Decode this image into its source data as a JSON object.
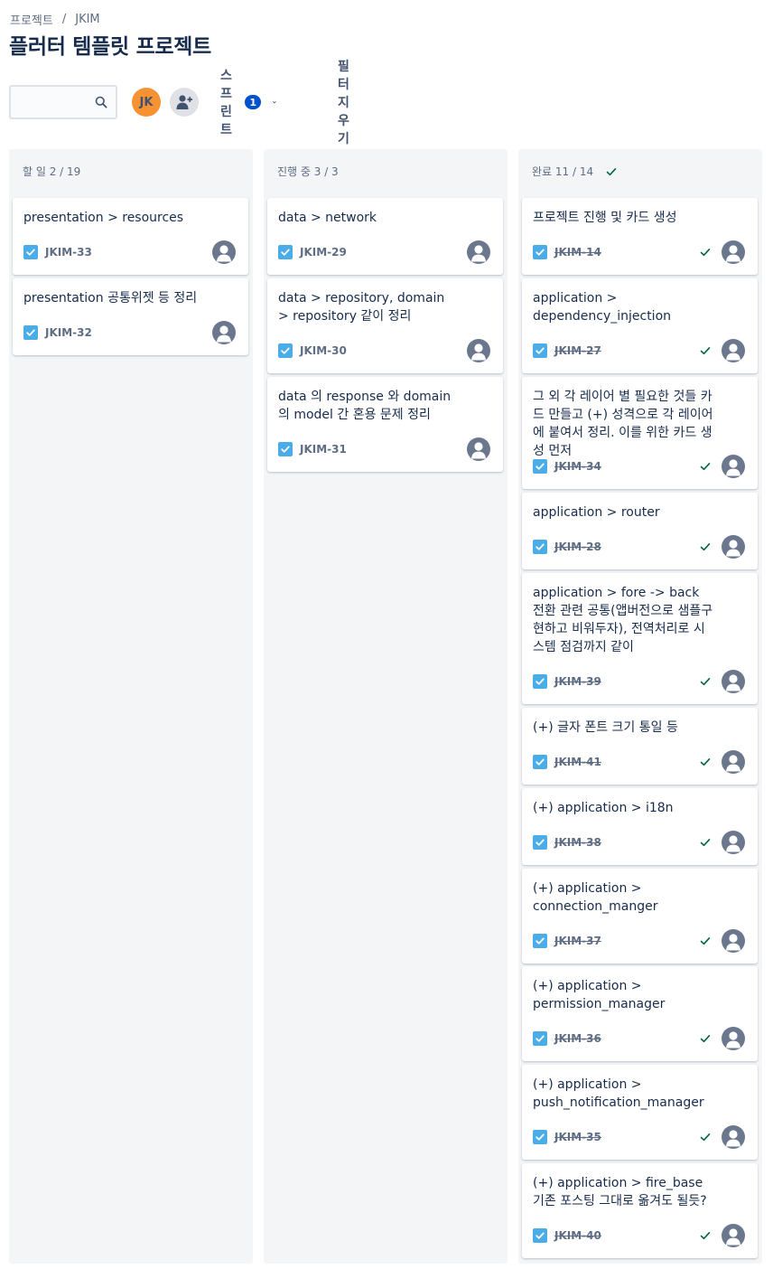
{
  "breadcrumb": {
    "projects": "프로젝트",
    "separator": "/",
    "project": "JKIM"
  },
  "page_title": "플러터 템플릿 프로젝트",
  "toolbar": {
    "search_placeholder": "",
    "avatar_initials": "JK",
    "sprint_label": "스프린트",
    "sprint_count": "1",
    "clear_filter_label": "필터 지우기"
  },
  "columns": [
    {
      "header": "할 일 2 / 19",
      "cards": [
        {
          "title": "presentation > resources",
          "key": "JKIM-33"
        },
        {
          "title": "presentation 공통위젯 등 정리",
          "key": "JKIM-32"
        }
      ]
    },
    {
      "header": "진행 중 3 / 3",
      "cards": [
        {
          "title": "data > network",
          "key": "JKIM-29"
        },
        {
          "title": "data > repository, domain > repository 같이 정리",
          "key": "JKIM-30"
        },
        {
          "title": "data 의 response 와 domain 의 model 간 혼용 문제 정리",
          "key": "JKIM-31"
        }
      ]
    },
    {
      "header": "완료 11 / 14",
      "cards": [
        {
          "title": "프로젝트 진행 및 카드 생성",
          "key": "JKIM-14"
        },
        {
          "title": "application > dependency_injection",
          "key": "JKIM-27"
        },
        {
          "title": "그 외 각 레이어 별 필요한 것들 카드 만들고 (+) 성격으로 각 레이어에 붙여서 정리. 이를 위한 카드 생성 먼저",
          "key": "JKIM-34"
        },
        {
          "title": "application > router",
          "key": "JKIM-28"
        },
        {
          "title": "application > fore -> back 전환 관련 공통(앱버전으로 샘플구현하고 비워두자), 전역처리로 시스템 점검까지 같이",
          "key": "JKIM-39"
        },
        {
          "title": "(+) 글자 폰트 크기 통일 등",
          "key": "JKIM-41"
        },
        {
          "title": "(+) application > i18n",
          "key": "JKIM-38"
        },
        {
          "title": "(+) application > connection_manger",
          "key": "JKIM-37"
        },
        {
          "title": "(+) application > permission_manager",
          "key": "JKIM-36"
        },
        {
          "title": "(+) application > push_notification_manager",
          "key": "JKIM-35"
        },
        {
          "title": "(+) application > fire_base 기존 포스팅 그대로 옮겨도 될듯?",
          "key": "JKIM-40"
        }
      ]
    }
  ]
}
